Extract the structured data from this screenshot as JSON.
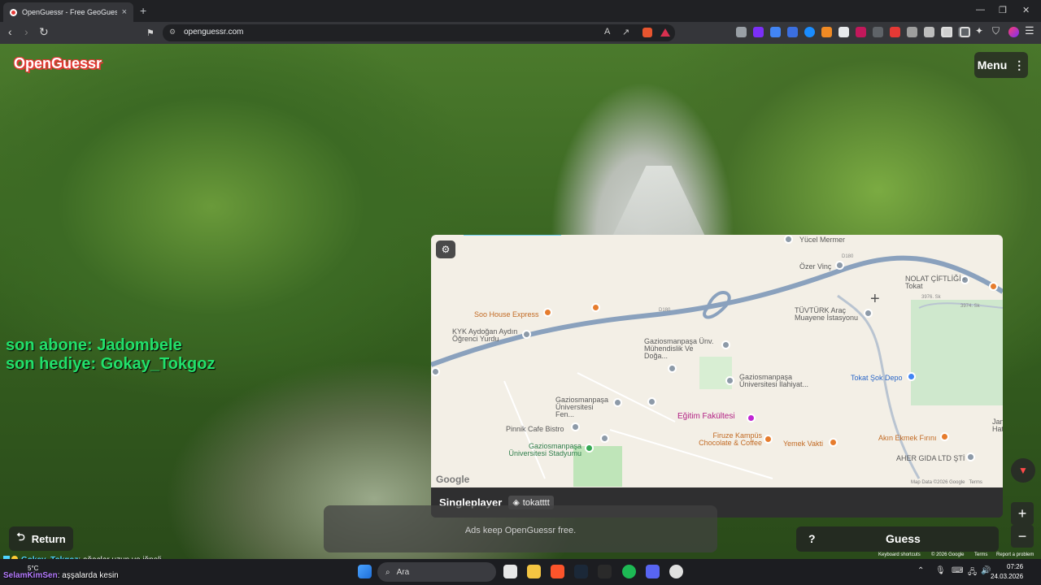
{
  "browser": {
    "tab_title": "OpenGuessr - Free GeoGuess",
    "tab_close": "×",
    "new_tab": "+",
    "url": "openguessr.com",
    "window_controls": [
      "—",
      "❐",
      "✕"
    ]
  },
  "game": {
    "logo": "OpenGuessr",
    "menu_label": "Menu",
    "menu_icon": "⋮",
    "overlay_line1": "son abone: Jadombele",
    "overlay_line2": "son hediye: Gokay_Tokgoz",
    "return_label": "Return",
    "return_icon": "⮌",
    "ads_text": "Ads keep OpenGuessr free.",
    "guess_help": "?",
    "guess_label": "Guess",
    "zoom_in": "+",
    "zoom_out": "−"
  },
  "map": {
    "mode": "Singleplayer",
    "username": "tokatttt",
    "google": "Google",
    "map_data": "Map Data ©2026 Google",
    "terms": "Terms",
    "road_labels": [
      "D180",
      "D180",
      "3976. Sk",
      "3974. Sk"
    ],
    "places": [
      {
        "label": "Yücel Mermer",
        "kind": "gray"
      },
      {
        "label": "Özer Vinç",
        "kind": "gray"
      },
      {
        "label": "NOLAT ÇİFTLİĞİ - Tokat",
        "kind": "gray"
      },
      {
        "label": "Soo House Express",
        "kind": "orange"
      },
      {
        "label": "KYK Aydoğan Aydın Öğrenci Yurdu",
        "kind": "gray"
      },
      {
        "label": "TÜVTÜRK Araç Muayene İstasyonu",
        "kind": "gray"
      },
      {
        "label": "Gaziosmanpaşa Ünv. Mühendislik Ve Doğa...",
        "kind": "gray"
      },
      {
        "label": "Gaziosmanpaşa Üniversitesi İlahiyat...",
        "kind": "gray"
      },
      {
        "label": "Tokat Şok Depo",
        "kind": "blue"
      },
      {
        "label": "Gaziosmanpaşa Üniversitesi Fen...",
        "kind": "gray"
      },
      {
        "label": "Eğitim Fakültesi",
        "kind": "pink"
      },
      {
        "label": "Pinnik Cafe Bistro",
        "kind": "gray"
      },
      {
        "label": "Firuze Kampüs Chocolate & Coffee",
        "kind": "orange"
      },
      {
        "label": "Yemek Vakti",
        "kind": "orange"
      },
      {
        "label": "Akın Ekmek Fırını",
        "kind": "orange"
      },
      {
        "label": "Gaziosmanpaşa Üniversitesi Stadyumu",
        "kind": "green"
      },
      {
        "label": "AHER GIDA LTD ŞTİ",
        "kind": "gray"
      },
      {
        "label": "Jan Hatira",
        "kind": "gray"
      }
    ]
  },
  "chat": [
    {
      "user": "Gokay_Tokgoz",
      "text": ": ağaçlar uzun ve iğneli"
    },
    {
      "user": "SelamKimSen",
      "text": ": aşşalarda kesin"
    }
  ],
  "google_footer": [
    "Keyboard shortcuts",
    "© 2026 Google",
    "Terms",
    "Report a problem"
  ],
  "taskbar": {
    "weather": "5°C",
    "search": "Ara",
    "time": "07:26",
    "date": "24.03.2026"
  }
}
